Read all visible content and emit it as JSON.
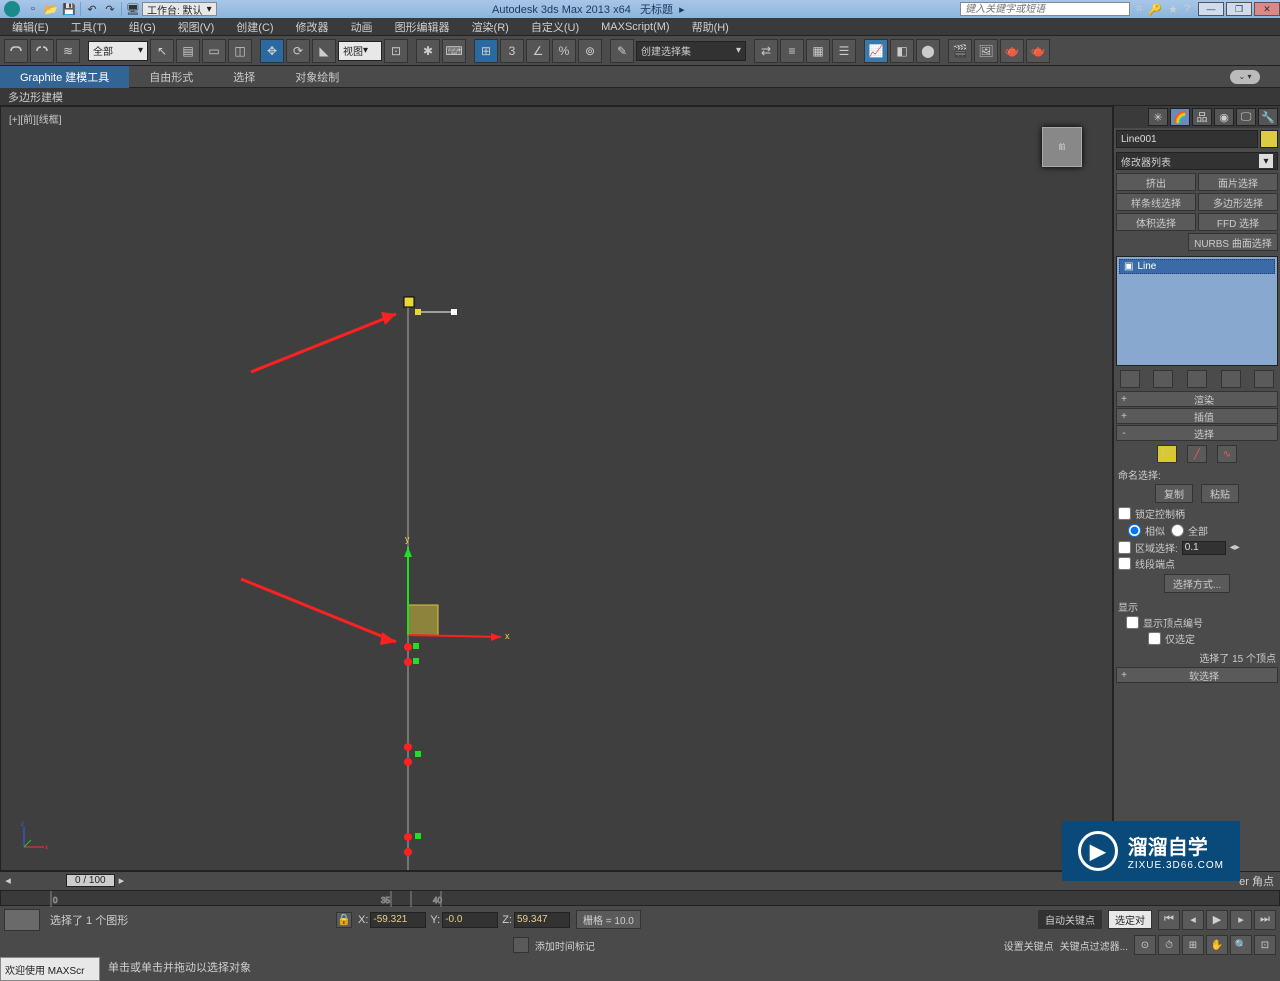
{
  "title": "Autodesk 3ds Max  2013 x64  ",
  "doc": "无标题",
  "workspace_label": "工作台: 默认",
  "search_placeholder": "键入关键字或短语",
  "menu": [
    "编辑(E)",
    "工具(T)",
    "组(G)",
    "视图(V)",
    "创建(C)",
    "修改器",
    "动画",
    "图形编辑器",
    "渲染(R)",
    "自定义(U)",
    "MAXScript(M)",
    "帮助(H)"
  ],
  "toolbar": {
    "filter": "全部",
    "coord": "视图",
    "namedset": "创建选择集"
  },
  "ribbon": {
    "tabs": [
      "Graphite 建模工具",
      "自由形式",
      "选择",
      "对象绘制"
    ],
    "sub": "多边形建模"
  },
  "viewport": {
    "label": "[+][前][线框]"
  },
  "panel": {
    "objname": "Line001",
    "modlist": "修改器列表",
    "buttons": [
      "挤出",
      "面片选择",
      "样条线选择",
      "多边形选择",
      "体积选择",
      "FFD 选择",
      "NURBS 曲面选择"
    ],
    "stack_item": "Line",
    "rollouts": [
      "渲染",
      "插值",
      "选择",
      "软选择"
    ],
    "named_sel": "命名选择:",
    "copy": "复制",
    "paste": "粘贴",
    "lock_handles": "锁定控制柄",
    "similar": "相似",
    "all": "全部",
    "area_sel": "区域选择:",
    "area_val": "0.1",
    "seg_end": "线段端点",
    "sel_method": "选择方式...",
    "display": "显示",
    "show_vn": "显示顶点编号",
    "only_sel": "仅选定",
    "sel_count": "选择了 15 个顶点"
  },
  "time": {
    "frame": "0 / 100"
  },
  "status": {
    "selmsg": "选择了 1 个图形",
    "x": "-59.321",
    "y": "-0.0",
    "z": "59.347",
    "grid": "栅格 = 10.0",
    "autokey": "自动关键点",
    "selset": "选定对",
    "setkey": "设置关键点",
    "keyfilter": "关键点过滤器...",
    "addtime": "添加时间标记",
    "corner": "er 角点"
  },
  "prompt": {
    "welcome": "欢迎使用  MAXScr",
    "hint": "单击或单击并拖动以选择对象"
  },
  "watermark": {
    "brand": "溜溜自学",
    "url": "ZIXUE.3D66.COM"
  }
}
